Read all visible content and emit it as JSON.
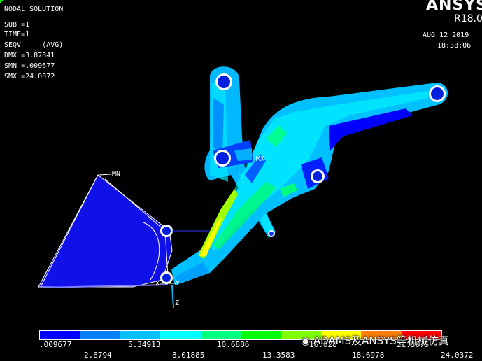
{
  "result_title": "NODAL SOLUTION",
  "info": {
    "sub": "SUB =1",
    "time": "TIME=1",
    "seqv": "SEQV     (AVG)",
    "dmx": "DMX =3.87841",
    "smn": "SMN =.009677",
    "smx": "SMX =24.0372"
  },
  "app": {
    "brand": "ANSYS",
    "version": "R18.0"
  },
  "datetime": {
    "date": "AUG 12 2019",
    "time": "18:38:06"
  },
  "markers": {
    "min": "MN",
    "max": "MX"
  },
  "triad": {
    "x": "X",
    "y": "Y",
    "z": "Z"
  },
  "legend": {
    "colors": [
      "#0000ff",
      "#0080ff",
      "#00c0ff",
      "#00ffff",
      "#00ff80",
      "#00ff00",
      "#80ff00",
      "#ffff00",
      "#ff8000",
      "#ff0000"
    ],
    "ticks_top": [
      ".009677",
      "5.34913",
      "10.6886",
      "16.028",
      "21.3675"
    ],
    "ticks_bottom": [
      "2.6794",
      "8.01885",
      "13.3583",
      "18.6978",
      "24.0372"
    ]
  },
  "watermark": "ADAMS及ANSYS等机械仿真"
}
